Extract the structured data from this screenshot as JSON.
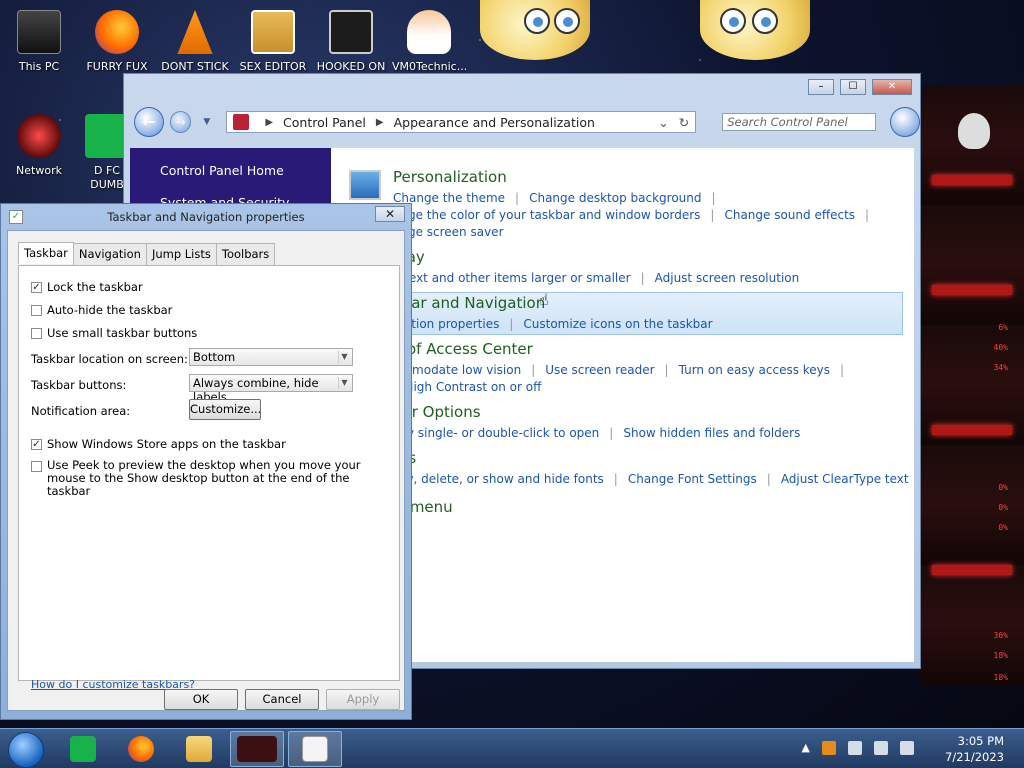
{
  "desktop": {
    "icons": [
      {
        "label": "This PC"
      },
      {
        "label": "FURRY FUX"
      },
      {
        "label": "DONT STICK"
      },
      {
        "label": "SEX EDITOR"
      },
      {
        "label": "HOOKED ON"
      },
      {
        "label": "VM0Technic..."
      },
      {
        "label": "Network"
      },
      {
        "label": "D FC DUMB"
      }
    ],
    "readouts": [
      "6%",
      "40%",
      "34%",
      "0%",
      "0%",
      "0%",
      "36%",
      "18%",
      "18%"
    ]
  },
  "control_panel": {
    "breadcrumb": [
      "Control Panel",
      "Appearance and Personalization"
    ],
    "search_placeholder": "Search Control Panel",
    "sidebar": {
      "home": "Control Panel Home",
      "system": "System and Security"
    },
    "categories": [
      {
        "title": "Personalization",
        "lines": [
          [
            "Change the theme",
            "Change desktop background"
          ],
          [
            "ange the color of your taskbar and window borders",
            "Change sound effects"
          ],
          [
            "ange screen saver"
          ]
        ]
      },
      {
        "title": "play",
        "lines": [
          [
            "e text and other items larger or smaller",
            "Adjust screen resolution"
          ]
        ]
      },
      {
        "title": "kbar and Navigation",
        "lines": [
          [
            "igation properties",
            "Customize icons on the taskbar"
          ]
        ]
      },
      {
        "title": "e of Access Center",
        "lines": [
          [
            "ommodate low vision",
            "Use screen reader",
            "Turn on easy access keys"
          ],
          [
            "n High Contrast on or off"
          ]
        ]
      },
      {
        "title": "der Options",
        "lines": [
          [
            "cify single- or double-click to open",
            "Show hidden files and folders"
          ]
        ]
      },
      {
        "title": "nts",
        "lines": [
          [
            "iew, delete, or show and hide fonts",
            "Change Font Settings",
            "Adjust ClearType text"
          ]
        ]
      },
      {
        "title": "rt menu",
        "lines": []
      }
    ]
  },
  "dialog": {
    "title": "Taskbar and Navigation properties",
    "tabs": [
      "Taskbar",
      "Navigation",
      "Jump Lists",
      "Toolbars"
    ],
    "checkboxes": [
      {
        "label": "Lock the taskbar",
        "checked": true
      },
      {
        "label": "Auto-hide the taskbar",
        "checked": false
      },
      {
        "label": "Use small taskbar buttons",
        "checked": false
      }
    ],
    "location_label": "Taskbar location on screen:",
    "location_value": "Bottom",
    "buttons_label": "Taskbar buttons:",
    "buttons_value": "Always combine, hide labels",
    "notification_label": "Notification area:",
    "customize": "Customize...",
    "store_label": "Show Windows Store apps on the taskbar",
    "peek_label": "Use Peek to preview the desktop when you move your mouse to the Show desktop button at the end of the taskbar",
    "help_link": "How do I customize taskbars?",
    "ok": "OK",
    "cancel": "Cancel",
    "apply": "Apply"
  },
  "taskbar": {
    "time": "3:05 PM",
    "date": "7/21/2023"
  },
  "colors": {
    "link": "#1a55b0",
    "category": "#1e5e1e",
    "sidebar": "#2a1a78"
  }
}
